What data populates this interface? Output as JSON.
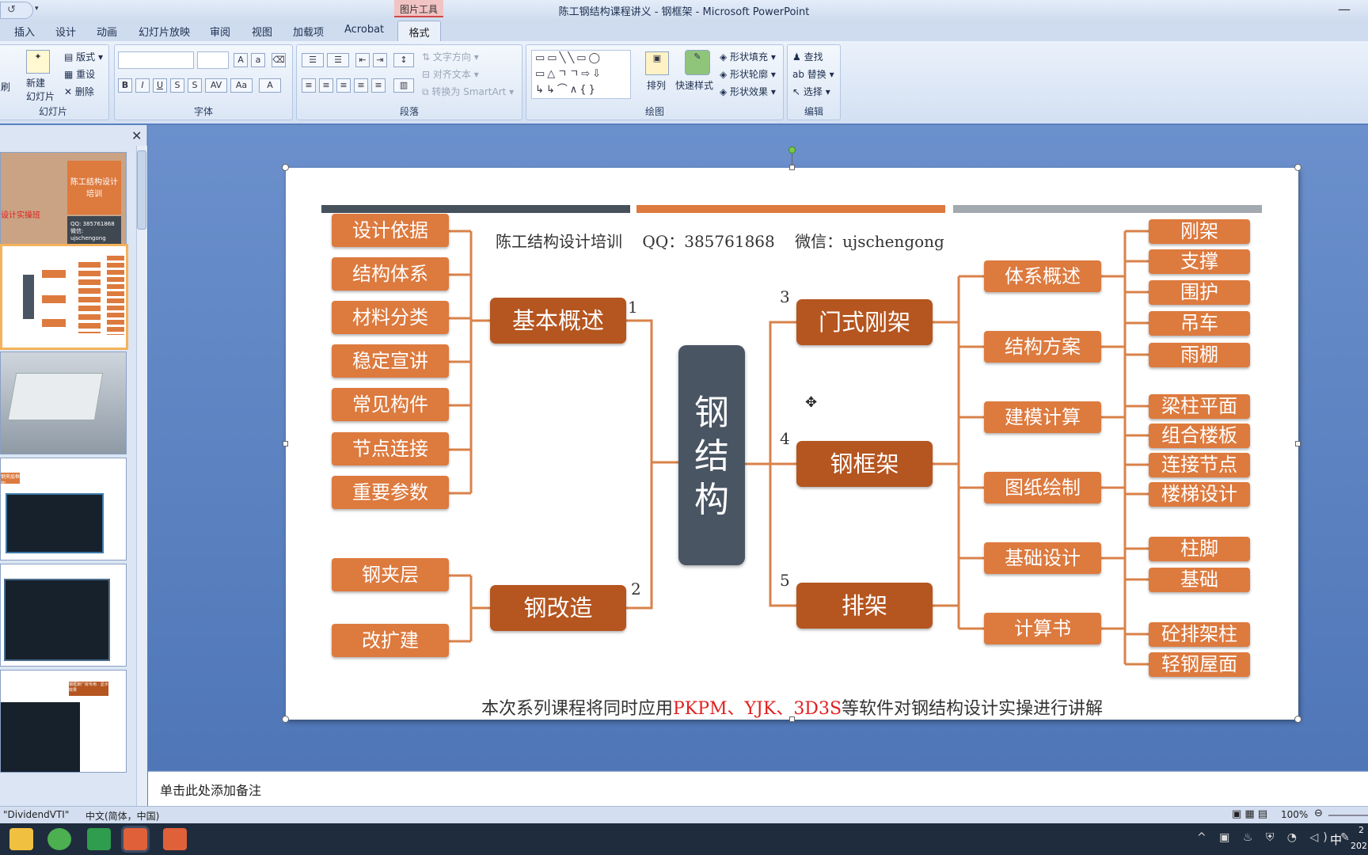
{
  "window": {
    "title": "陈工钢结构课程讲义 - 钢框架 - Microsoft PowerPoint",
    "context_group": "图片工具"
  },
  "tabs": [
    "插入",
    "设计",
    "动画",
    "幻灯片放映",
    "审阅",
    "视图",
    "加载项",
    "Acrobat",
    "格式"
  ],
  "ribbon": {
    "slides": {
      "label": "幻灯片",
      "new_slide": "新建\n幻灯片",
      "layout": "版式",
      "reset": "重设",
      "delete": "删除",
      "cut_label": "刷"
    },
    "font": {
      "label": "字体"
    },
    "paragraph": {
      "label": "段落",
      "text_direction": "文字方向",
      "align_text": "对齐文本",
      "smartart": "转换为 SmartArt"
    },
    "drawing": {
      "label": "绘图",
      "arrange": "排列",
      "quick_styles": "快速样式",
      "shape_fill": "形状填充",
      "shape_outline": "形状轮廓",
      "shape_effects": "形状效果"
    },
    "editing": {
      "label": "编辑",
      "find": "查找",
      "replace": "替换",
      "select": "选择"
    }
  },
  "thumbs": [
    {
      "title": "陈工结构设计培训",
      "line1": "QQ: 385761868",
      "line2": "微信: ujschengong",
      "tag": "设计实操班"
    },
    {
      "title": ""
    },
    {
      "title": ""
    },
    {
      "title": "钢夹层框架"
    },
    {
      "title": ""
    },
    {
      "title": "钢框架厂房专用 · 显示效果"
    }
  ],
  "slide": {
    "header": "陈工结构设计培训    QQ：385761868    微信：ujschengong",
    "center": "钢结构",
    "footer_pre": "本次系列课程将同时应用",
    "footer_hl": "PKPM、YJK、3D3S",
    "footer_post": "等软件对钢结构设计实操进行讲解",
    "left_top_items": [
      "设计依据",
      "结构体系",
      "材料分类",
      "稳定宣讲",
      "常见构件",
      "节点连接",
      "重要参数"
    ],
    "left_bottom_items": [
      "钢夹层",
      "改扩建"
    ],
    "main_left": [
      {
        "label": "基本概述",
        "num": "1"
      },
      {
        "label": "钢改造",
        "num": "2"
      }
    ],
    "main_right": [
      {
        "label": "门式刚架",
        "num": "3"
      },
      {
        "label": "钢框架",
        "num": "4"
      },
      {
        "label": "排架",
        "num": "5"
      }
    ],
    "sub_right": [
      "体系概述",
      "结构方案",
      "建模计算",
      "图纸绘制",
      "基础设计",
      "计算书"
    ],
    "far_right": [
      "刚架",
      "支撑",
      "围护",
      "吊车",
      "雨棚",
      "梁柱平面",
      "组合楼板",
      "连接节点",
      "楼梯设计",
      "柱脚",
      "基础",
      "砼排架柱",
      "轻钢屋面"
    ],
    "colors": {
      "bar1": "#46515c",
      "bar2": "#dd7a3e",
      "bar3": "#a3a9b0",
      "node": "#dd7a3e",
      "main": "#b5551f",
      "center": "#4a5563",
      "line": "#d9824a",
      "highlight": "#e02020"
    }
  },
  "notes": {
    "placeholder": "单击此处添加备注"
  },
  "status": {
    "theme": "\"DividendVTI\"",
    "language": "中文(简体，中国)",
    "zoom": "100%"
  },
  "taskbar": {
    "ime": "中",
    "time_a": "2",
    "time_b": "202"
  }
}
